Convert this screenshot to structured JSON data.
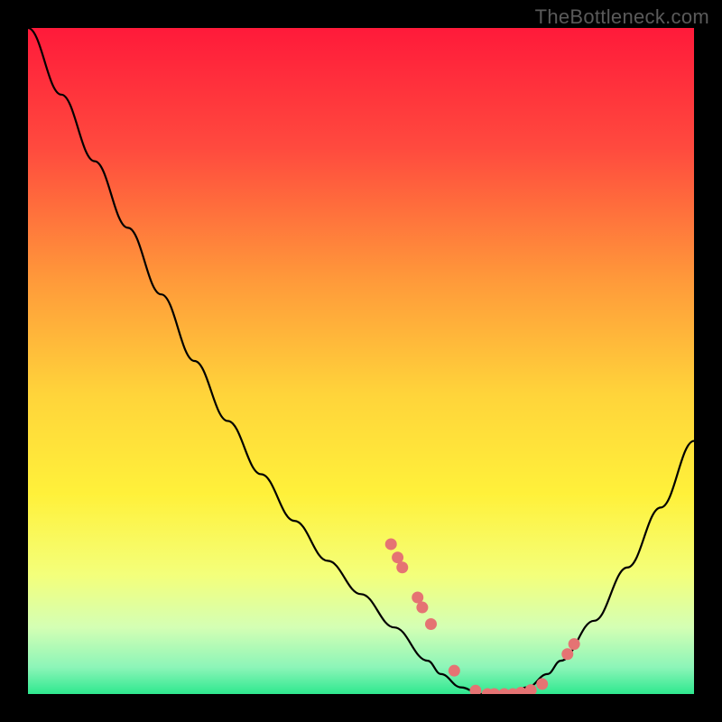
{
  "attribution": "TheBottleneck.com",
  "chart_data": {
    "type": "line",
    "title": "",
    "xlabel": "",
    "ylabel": "",
    "x": [
      0.0,
      0.05,
      0.1,
      0.15,
      0.2,
      0.25,
      0.3,
      0.35,
      0.4,
      0.45,
      0.5,
      0.55,
      0.6,
      0.62,
      0.65,
      0.68,
      0.7,
      0.72,
      0.75,
      0.78,
      0.8,
      0.85,
      0.9,
      0.95,
      1.0
    ],
    "y": [
      1.0,
      0.9,
      0.8,
      0.7,
      0.6,
      0.5,
      0.41,
      0.33,
      0.26,
      0.2,
      0.15,
      0.1,
      0.05,
      0.03,
      0.01,
      0.0,
      0.0,
      0.0,
      0.01,
      0.03,
      0.05,
      0.11,
      0.19,
      0.28,
      0.38
    ],
    "ylim": [
      0,
      1
    ],
    "xlim": [
      0,
      1
    ],
    "background_gradient": {
      "type": "vertical",
      "stops": [
        {
          "pos": 0.0,
          "color": "#ff1a3a"
        },
        {
          "pos": 0.18,
          "color": "#ff4a3e"
        },
        {
          "pos": 0.38,
          "color": "#ff9a3a"
        },
        {
          "pos": 0.55,
          "color": "#ffd43a"
        },
        {
          "pos": 0.7,
          "color": "#fff13a"
        },
        {
          "pos": 0.82,
          "color": "#f4ff7a"
        },
        {
          "pos": 0.9,
          "color": "#d4ffb4"
        },
        {
          "pos": 0.96,
          "color": "#8cf5b8"
        },
        {
          "pos": 1.0,
          "color": "#2ee88f"
        }
      ]
    },
    "markers": [
      {
        "x": 0.545,
        "y": 0.225
      },
      {
        "x": 0.555,
        "y": 0.205
      },
      {
        "x": 0.562,
        "y": 0.19
      },
      {
        "x": 0.585,
        "y": 0.145
      },
      {
        "x": 0.592,
        "y": 0.13
      },
      {
        "x": 0.605,
        "y": 0.105
      },
      {
        "x": 0.64,
        "y": 0.035
      },
      {
        "x": 0.672,
        "y": 0.005
      },
      {
        "x": 0.69,
        "y": 0.0
      },
      {
        "x": 0.7,
        "y": 0.0
      },
      {
        "x": 0.715,
        "y": 0.0
      },
      {
        "x": 0.728,
        "y": 0.0
      },
      {
        "x": 0.74,
        "y": 0.002
      },
      {
        "x": 0.755,
        "y": 0.006
      },
      {
        "x": 0.772,
        "y": 0.015
      },
      {
        "x": 0.81,
        "y": 0.06
      },
      {
        "x": 0.82,
        "y": 0.075
      }
    ],
    "marker_color": "#e57373",
    "curve_color": "#000000"
  }
}
